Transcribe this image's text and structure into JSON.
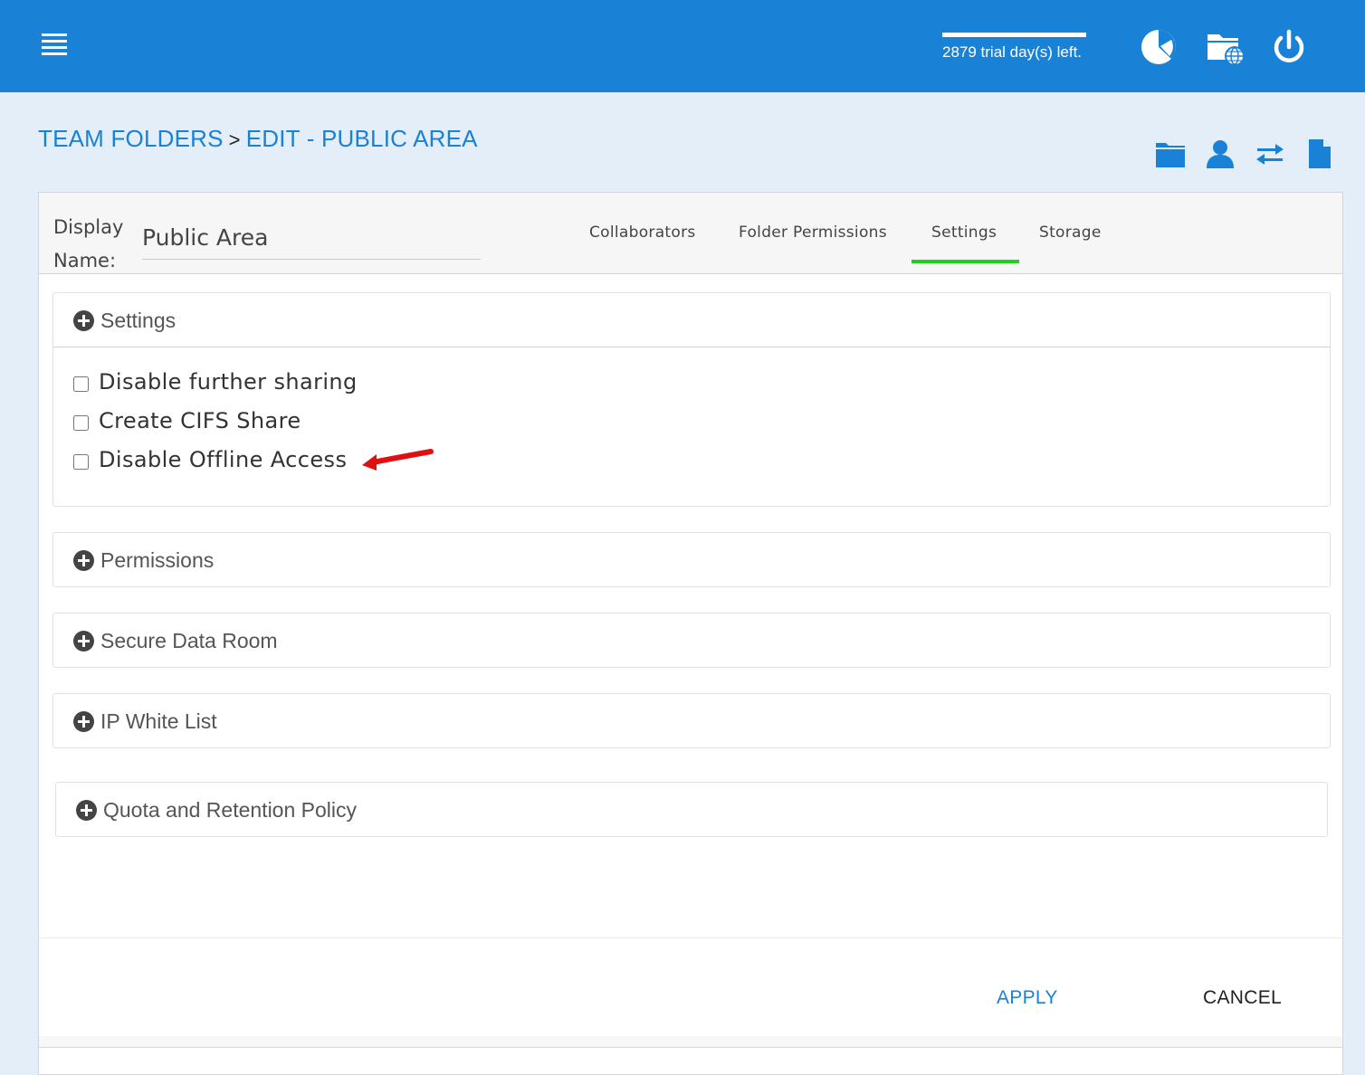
{
  "header": {
    "trial_text": "2879 trial day(s) left.",
    "icons": [
      "menu-icon",
      "dashboard-pie-icon",
      "web-folder-icon",
      "power-icon"
    ]
  },
  "breadcrumb": {
    "parent": "TEAM FOLDERS",
    "separator": ">",
    "current": "EDIT - PUBLIC AREA"
  },
  "toolbar_icons": [
    "folder-icon",
    "user-icon",
    "sync-arrows-icon",
    "document-icon"
  ],
  "form": {
    "display_name_label_1": "Display",
    "display_name_label_2": "Name:",
    "display_name_value": "Public Area"
  },
  "tabs": [
    {
      "label": "Collaborators",
      "active": false
    },
    {
      "label": "Folder Permissions",
      "active": false
    },
    {
      "label": "Settings",
      "active": true
    },
    {
      "label": "Storage",
      "active": false
    }
  ],
  "sections": {
    "settings": {
      "title": "Settings",
      "options": [
        {
          "label": "Disable further sharing",
          "checked": false
        },
        {
          "label": "Create CIFS Share",
          "checked": false
        },
        {
          "label": "Disable Offline Access",
          "checked": false
        }
      ]
    },
    "permissions": {
      "title": "Permissions"
    },
    "secure_data_room": {
      "title": "Secure Data Room"
    },
    "ip_white_list": {
      "title": "IP White List"
    },
    "quota_retention": {
      "title": "Quota and Retention Policy"
    }
  },
  "footer": {
    "apply_label": "APPLY",
    "cancel_label": "CANCEL"
  },
  "colors": {
    "brand": "#1a82d6",
    "active_tab": "#1ed11e",
    "annotation_arrow": "#e01010"
  }
}
